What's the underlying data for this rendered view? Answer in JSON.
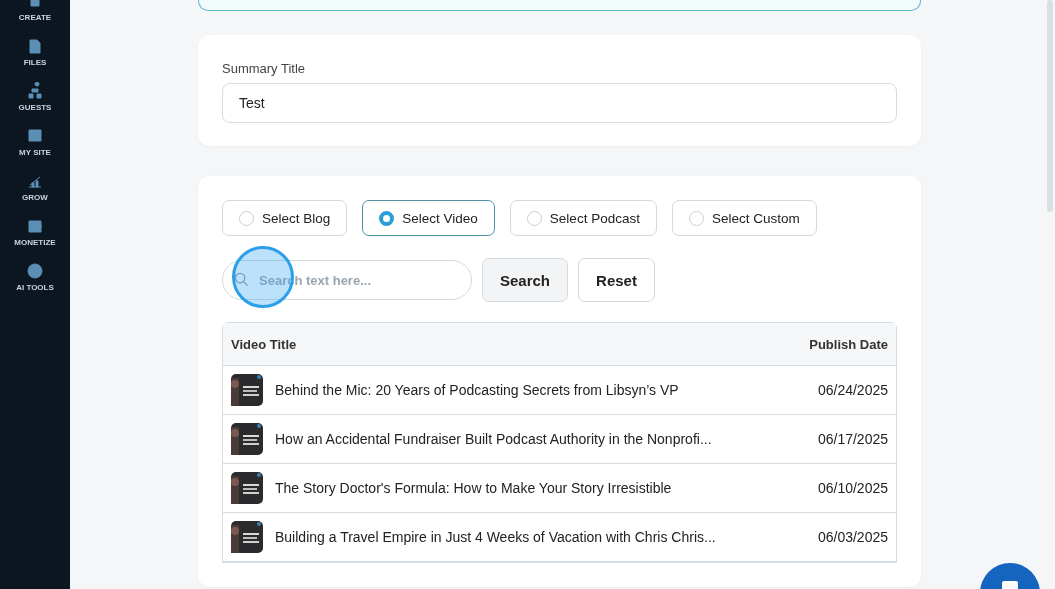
{
  "sidebar": {
    "items": [
      {
        "label": "CREATE"
      },
      {
        "label": "FILES"
      },
      {
        "label": "GUESTS"
      },
      {
        "label": "MY SITE"
      },
      {
        "label": "GROW"
      },
      {
        "label": "MONETIZE"
      },
      {
        "label": "AI TOOLS"
      }
    ]
  },
  "summary": {
    "label": "Summary Title",
    "value": "Test"
  },
  "source_options": [
    {
      "label": "Select Blog",
      "selected": false
    },
    {
      "label": "Select Video",
      "selected": true
    },
    {
      "label": "Select Podcast",
      "selected": false
    },
    {
      "label": "Select Custom",
      "selected": false
    }
  ],
  "search": {
    "placeholder": "Search text here...",
    "buttons": [
      "Search",
      "Reset"
    ]
  },
  "table": {
    "columns": [
      "Video Title",
      "Publish Date"
    ],
    "rows": [
      {
        "title": "Behind the Mic: 20 Years of Podcasting Secrets from Libsyn’s VP",
        "date": "06/24/2025"
      },
      {
        "title": "How an Accidental Fundraiser Built Podcast Authority in the Nonprofi...",
        "date": "06/17/2025"
      },
      {
        "title": "The Story Doctor's Formula: How to Make Your Story Irresistible",
        "date": "06/10/2025"
      },
      {
        "title": "Building a Travel Empire in Just 4 Weeks of Vacation with Chris Chris...",
        "date": "06/03/2025"
      }
    ]
  }
}
